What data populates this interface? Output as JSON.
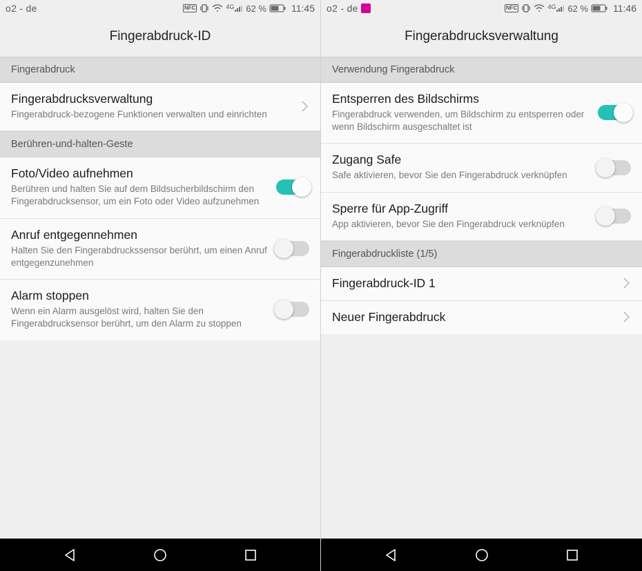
{
  "left": {
    "status": {
      "carrier": "o2 - de",
      "battery": "62 %",
      "time": "11:45",
      "network": "4G",
      "nfc": "NFC"
    },
    "title": "Fingerabdruck-ID",
    "section1": "Fingerabdruck",
    "manage": {
      "title": "Fingerabdrucksverwaltung",
      "sub": "Fingerabdruck-bezogene Funktionen verwalten und einrichten"
    },
    "section2": "Berühren-und-halten-Geste",
    "photo": {
      "title": "Foto/Video aufnehmen",
      "sub": "Berühren und halten Sie auf dem Bildsucherbildschirm den Fingerabdrucksensor, um ein Foto oder Video aufzunehmen",
      "on": true
    },
    "call": {
      "title": "Anruf entgegennehmen",
      "sub": "Halten Sie den Fingerabdruckssensor berührt, um einen Anruf entgegenzunehmen",
      "on": false
    },
    "alarm": {
      "title": "Alarm stoppen",
      "sub": "Wenn ein Alarm ausgelöst wird, halten Sie den Fingerabdrucksensor berührt, um den Alarm zu stoppen",
      "on": false
    }
  },
  "right": {
    "status": {
      "carrier": "o2 - de",
      "battery": "62 %",
      "time": "11:46",
      "network": "4G",
      "nfc": "NFC"
    },
    "title": "Fingerabdrucksverwaltung",
    "section1": "Verwendung Fingerabdruck",
    "unlock": {
      "title": "Entsperren des Bildschirms",
      "sub": "Fingerabdruck verwenden, um Bildschirm zu entsperren oder wenn Bildschirm ausgeschaltet ist",
      "on": true
    },
    "safe": {
      "title": "Zugang Safe",
      "sub": "Safe aktivieren, bevor Sie den Fingerabdruck verknüpfen",
      "on": false
    },
    "applock": {
      "title": "Sperre für App-Zugriff",
      "sub": "App aktivieren, bevor Sie den Fingerabdruck verknüpfen",
      "on": false
    },
    "section2": "Fingerabdruckliste (1/5)",
    "fp1": {
      "title": "Fingerabdruck-ID 1"
    },
    "newfp": {
      "title": "Neuer Fingerabdruck"
    }
  },
  "colors": {
    "accent": "#26c1b6"
  }
}
